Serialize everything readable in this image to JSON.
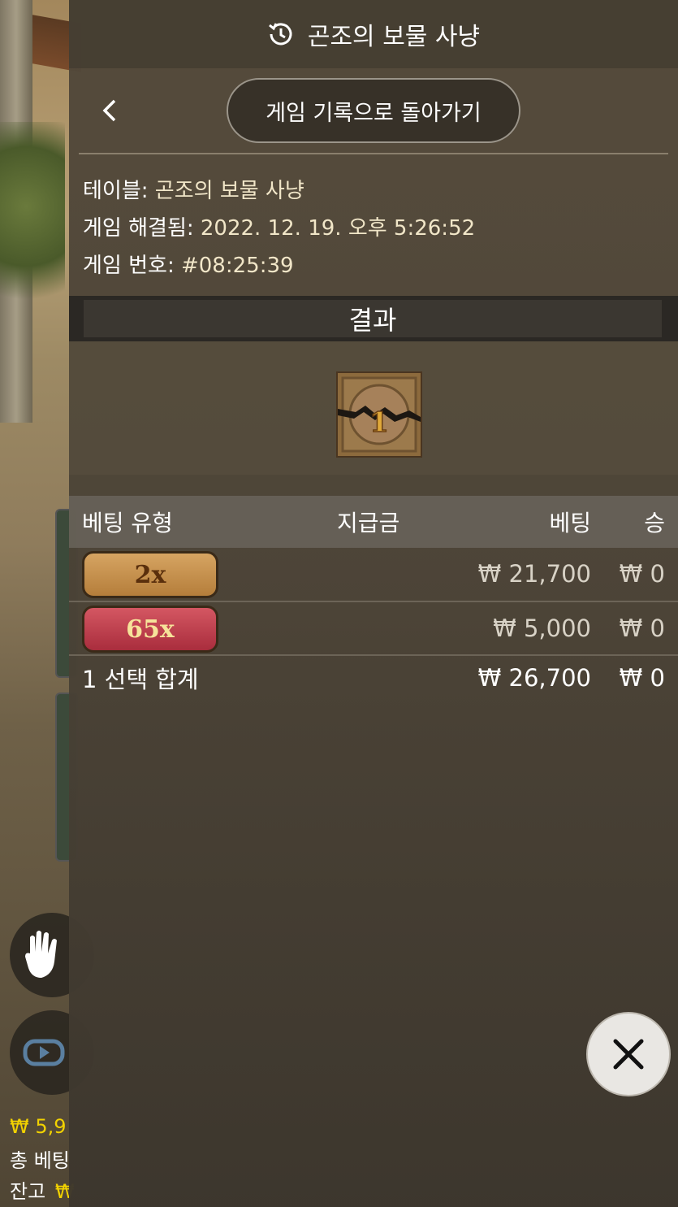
{
  "background": {
    "balance_amount": "₩ 5,9",
    "total_bet_label": "총 베팅",
    "balance_label": "잔고",
    "balance_value": "₩"
  },
  "header": {
    "title": "곤조의 보물 사냥",
    "icon": "history-icon"
  },
  "nav": {
    "back_icon": "chevron-left-icon",
    "history_button": "게임 기록으로 돌아가기"
  },
  "info": {
    "table_label": "테이블:",
    "table_value": "곤조의 보물 사냥",
    "resolved_label": "게임 해결됨:",
    "resolved_value": "2022. 12. 19. 오후 5:26:52",
    "game_no_label": "게임 번호:",
    "game_no_value": "#08:25:39"
  },
  "result": {
    "header": "결과",
    "tile_value": "1"
  },
  "bets_table": {
    "headers": {
      "type": "베팅 유형",
      "payout": "지급금",
      "bet": "베팅",
      "win": "승"
    },
    "rows": [
      {
        "chip": "2x",
        "chip_color": "#c48d4a",
        "bet": "₩ 21,700",
        "win": "₩ 0"
      },
      {
        "chip": "65x",
        "chip_color": "#c43f4e",
        "bet": "₩ 5,000",
        "win": "₩ 0"
      }
    ],
    "total": {
      "label": "1 선택 합계",
      "bet": "₩ 26,700",
      "win": "₩ 0"
    }
  },
  "close_icon": "close-icon"
}
